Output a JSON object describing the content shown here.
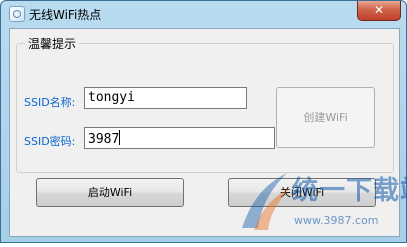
{
  "window": {
    "title": "无线WiFi热点",
    "close_symbol": "✕"
  },
  "group": {
    "title": "温馨提示"
  },
  "ssid_name": {
    "label": "SSID名称:",
    "value": "tongyi"
  },
  "ssid_password": {
    "label": "SSID密码:",
    "value": "3987"
  },
  "buttons": {
    "create": "创建WiFi",
    "start": "启动WiFi",
    "stop": "关闭WiFi"
  },
  "watermark": {
    "brand": "统一下载站",
    "url": "www.3987.com"
  },
  "colors": {
    "label_blue": "#0a66d0",
    "close_red": "#c0402a"
  }
}
